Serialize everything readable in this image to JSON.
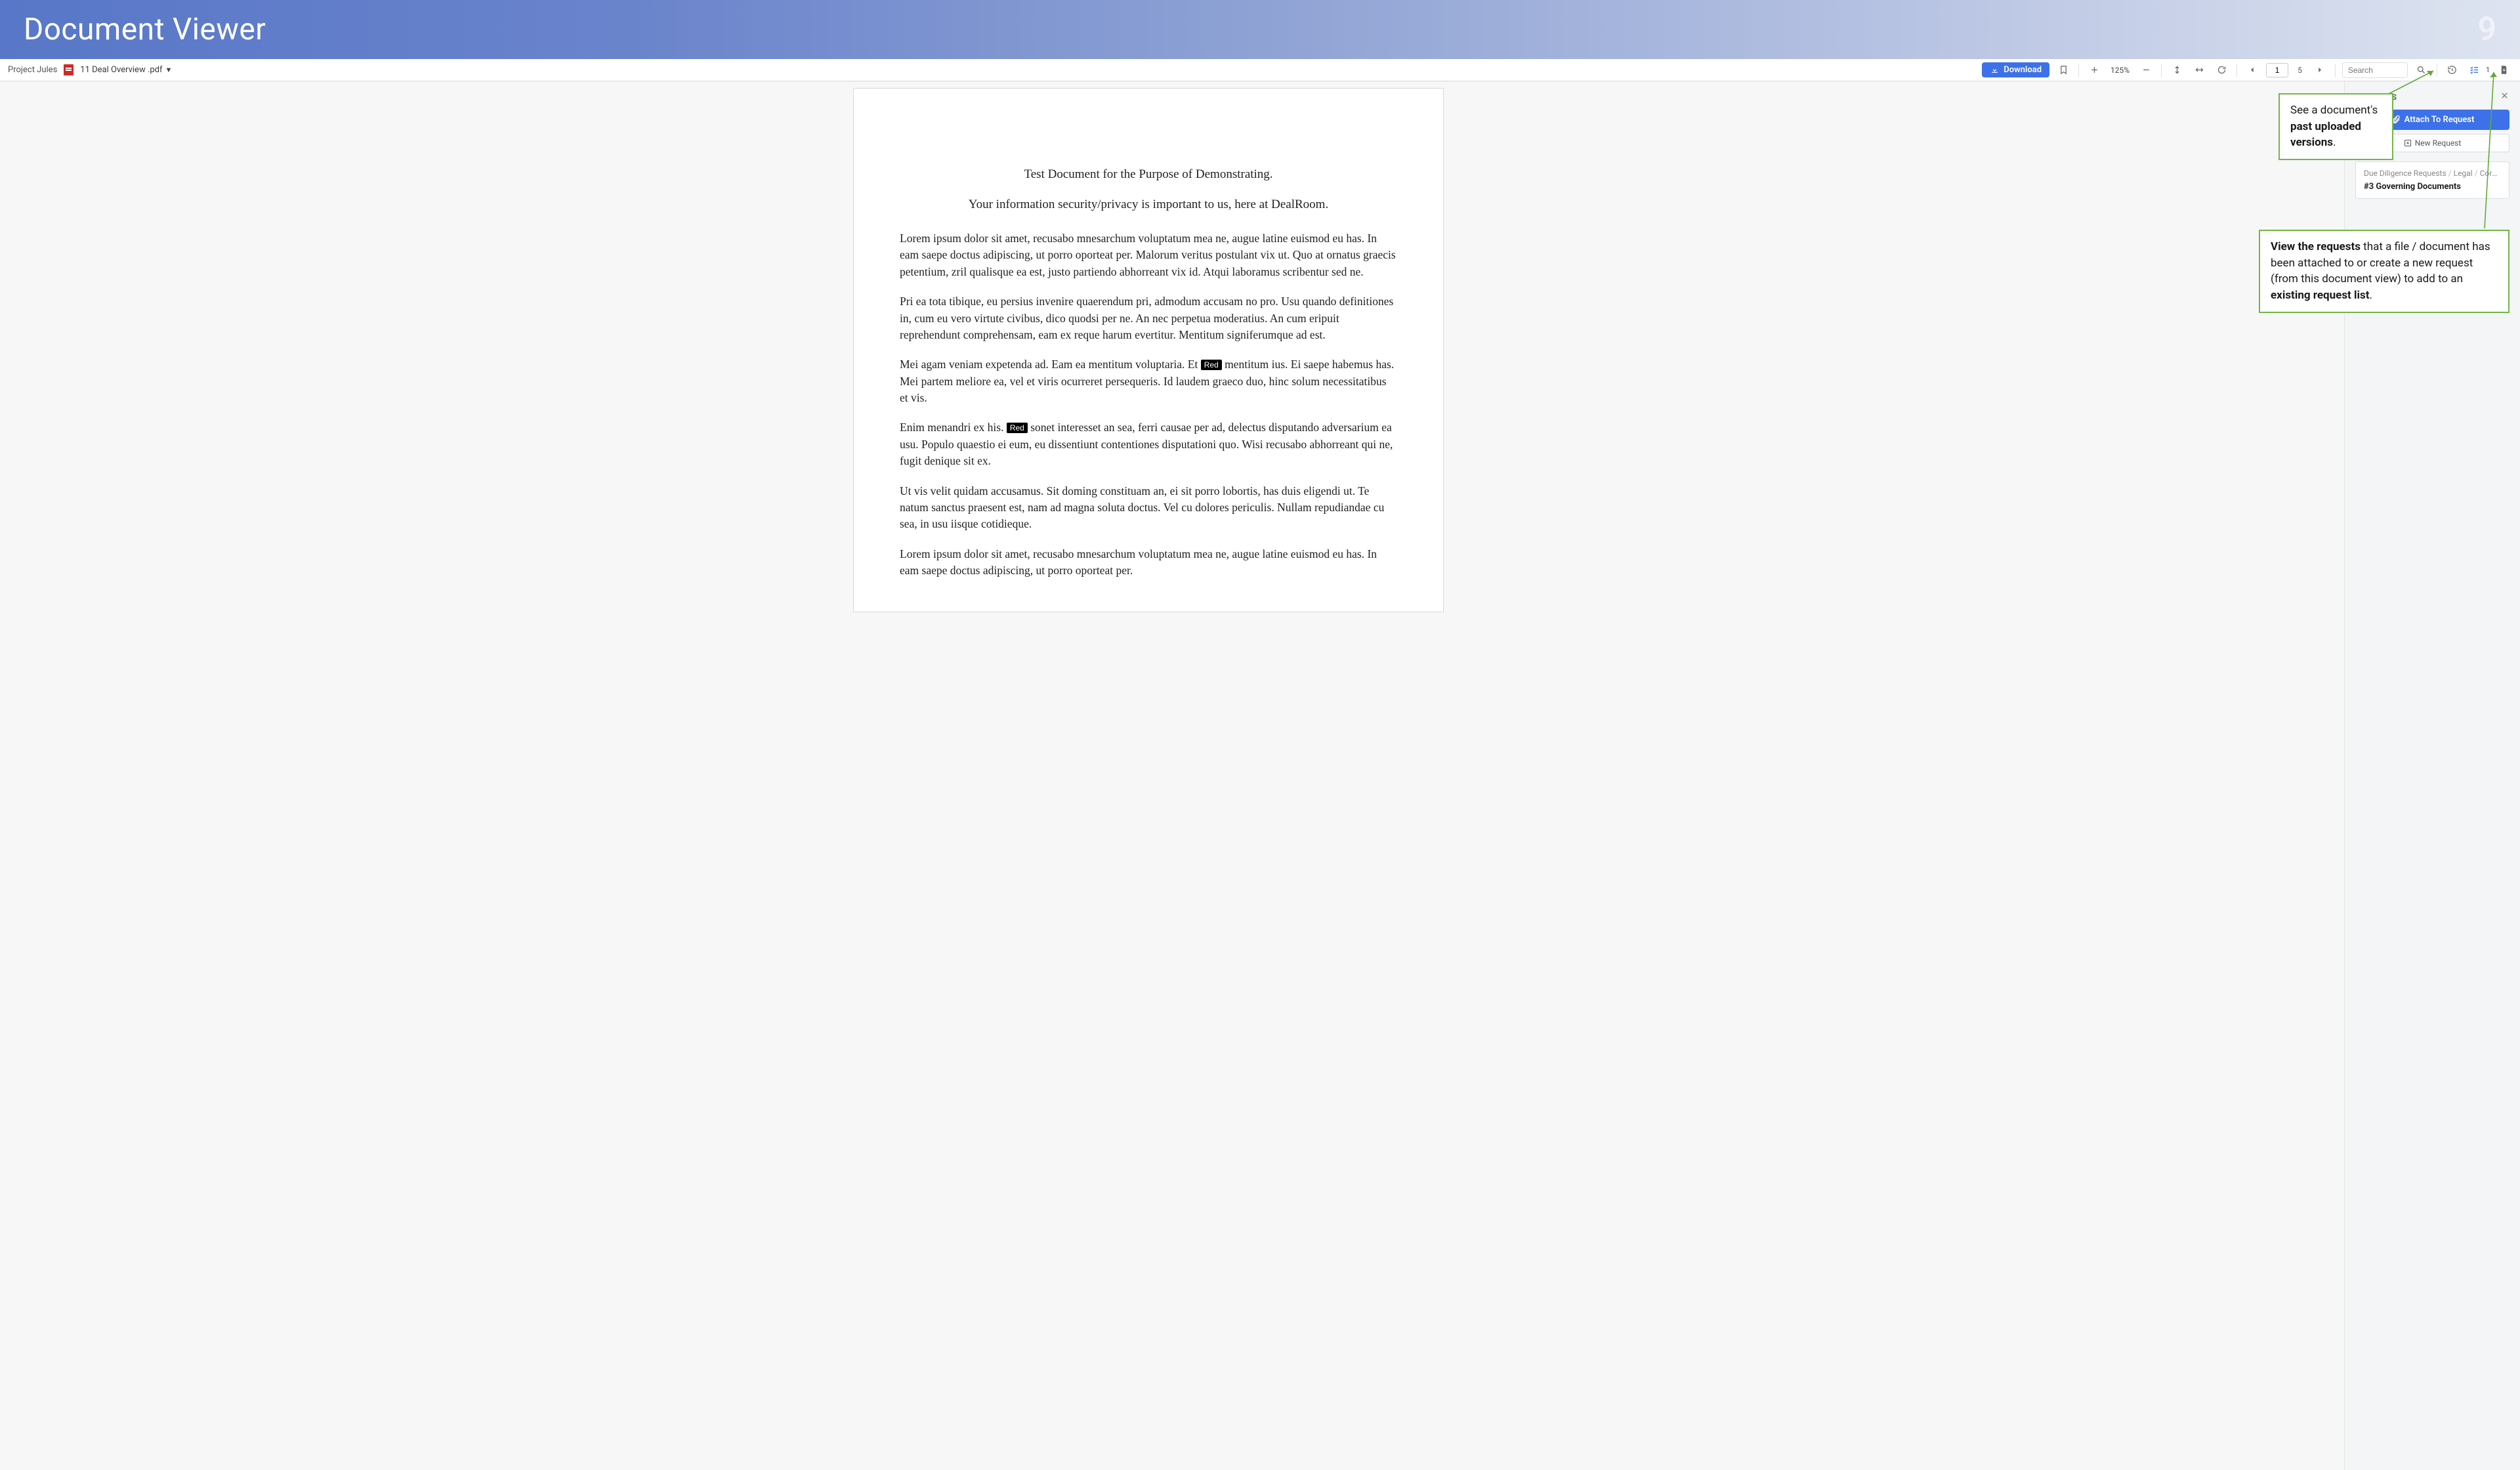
{
  "banner": {
    "title": "Document Viewer",
    "page_number": "9"
  },
  "toolbar": {
    "project": "Project Jules",
    "file_name": "11 Deal Overview .pdf",
    "download": "Download",
    "zoom": "125%",
    "page_current": "1",
    "page_total": "5",
    "search_placeholder": "Search",
    "requests_count": "1"
  },
  "document": {
    "title1": "Test Document for the Purpose of Demonstrating.",
    "title2": "Your information security/privacy is important to us, here at DealRoom.",
    "para1": "Lorem ipsum dolor sit amet, recusabo mnesarchum voluptatum mea ne, augue latine euismod eu has. In eam saepe doctus adipiscing, ut porro oporteat per. Malorum veritus postulant vix ut. Quo at ornatus graecis petentium, zril qualisque ea est, justo partiendo abhorreant vix id. Atqui laboramus scribentur sed ne.",
    "para2": "Pri ea tota tibique, eu persius invenire quaerendum pri, admodum accusam no pro. Usu quando definitiones in, cum eu vero virtute civibus, dico quodsi per ne. An nec perpetua moderatius. An cum eripuit reprehendunt comprehensam, eam ex reque harum evertitur. Mentitum signiferumque ad est.",
    "p3a": "Mei agam veniam expetenda ad. Eam ea mentitum voluptaria. Et ",
    "p3b": " mentitum ius. Ei saepe habemus has. Mei partem meliore ea, vel et viris ocurreret persequeris. Id laudem graeco duo, hinc solum necessitatibus et vis.",
    "p4a": "Enim menandri ex his. ",
    "p4b": " sonet interesset an sea, ferri causae per ad, delectus disputando adversarium ea usu. Populo quaestio ei eum, eu dissentiunt contentiones disputationi quo. Wisi recusabo abhorreant qui ne, fugit denique sit ex.",
    "para5": "Ut vis velit quidam accusamus. Sit doming constituam an, ei sit porro lobortis, has duis eligendi ut. Te natum sanctus praesent est, nam ad magna soluta doctus. Vel cu dolores periculis. Nullam repudiandae cu sea, in usu iisque cotidieque.",
    "para6": "Lorem ipsum dolor sit amet, recusabo mnesarchum voluptatum mea ne, augue latine euismod eu has. In eam saepe doctus adipiscing, ut porro oporteat per.",
    "redact": "Red"
  },
  "requests_panel": {
    "title": "REQUESTS",
    "attach": "Attach To Request",
    "new_req": "New Request",
    "crumb1": "Due Diligence Requests",
    "crumb2": "Legal",
    "crumb3": "Corpora...",
    "item": "#3 Governing Documents"
  },
  "callouts": {
    "c1a": "See a document's ",
    "c1b": "past uploaded versions",
    "c1c": ".",
    "c2a": "View the requests",
    "c2b": " that a file / document has been attached to or create a new request (from this document view) to add to an ",
    "c2c": "existing request list",
    "c2d": "."
  }
}
